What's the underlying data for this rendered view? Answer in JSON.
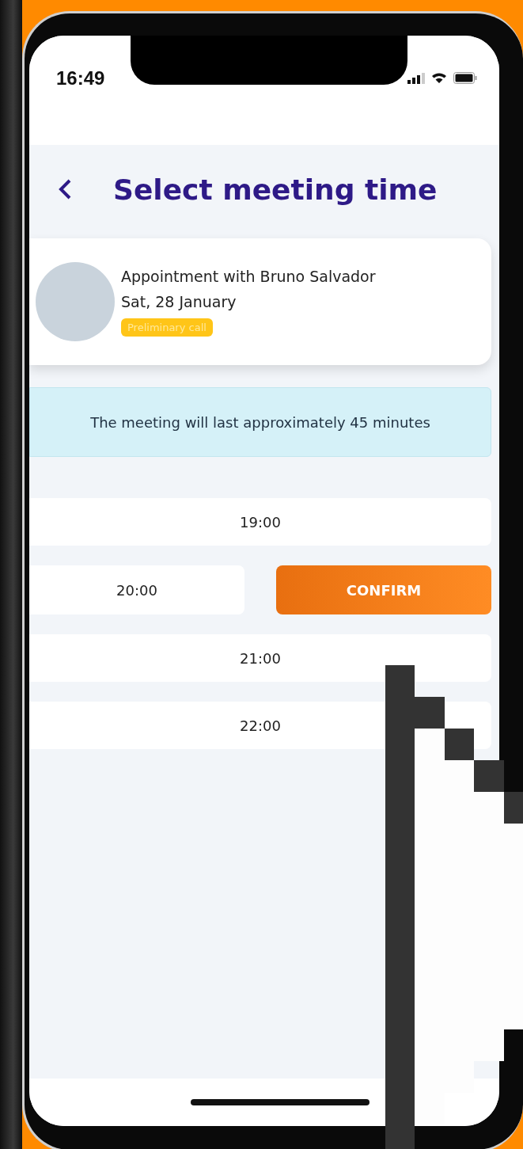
{
  "status_bar": {
    "time": "16:49"
  },
  "header": {
    "title": "Select meeting time"
  },
  "appointment": {
    "title": "Appointment with Bruno Salvador",
    "date": "Sat, 28 January",
    "tag": "Preliminary call"
  },
  "notice": "The meeting will last approximately 45 minutes",
  "slots": [
    {
      "time": "19:00",
      "selected": false
    },
    {
      "time": "20:00",
      "selected": true
    },
    {
      "time": "21:00",
      "selected": false
    },
    {
      "time": "22:00",
      "selected": false
    }
  ],
  "confirm_button": "CONFIRM"
}
